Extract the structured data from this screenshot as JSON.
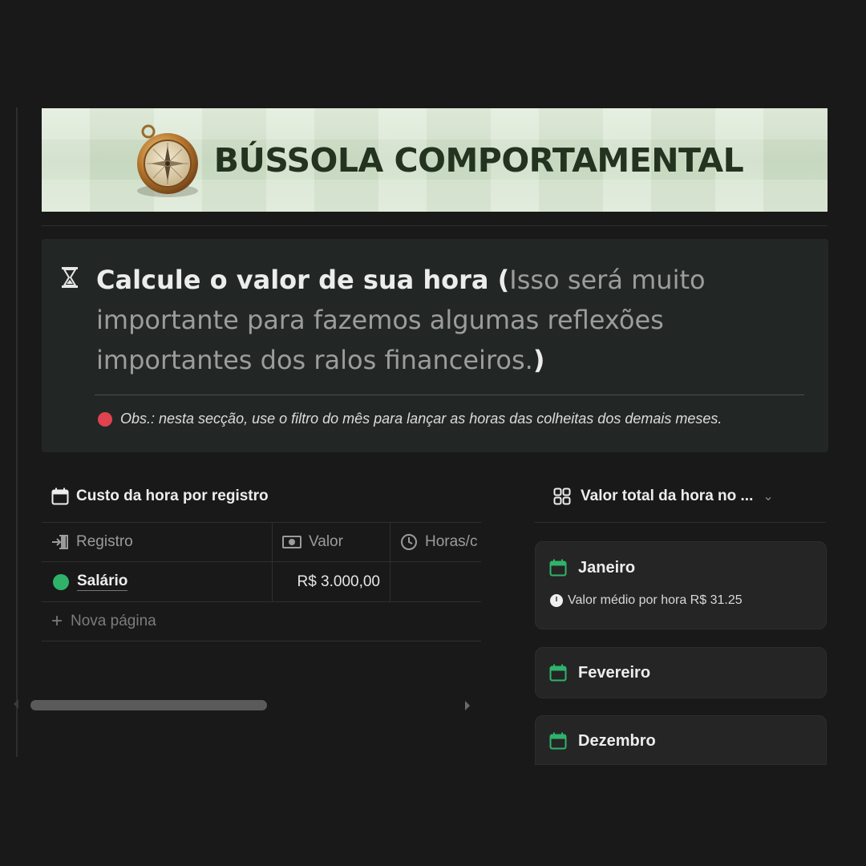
{
  "banner": {
    "title": "BÚSSOLA COMPORTAMENTAL",
    "icon": "compass-icon"
  },
  "callout": {
    "icon": "hourglass-icon",
    "heading_strong": "Calcule o valor de sua hora",
    "heading_paren_open": " (",
    "heading_muted": "Isso será muito importante para fazemos algumas reflexões importantes dos ralos financeiros.",
    "heading_paren_close": ")",
    "note": "Obs.: nesta secção, use o filtro do mês para lançar as horas das colheitas dos demais meses.",
    "note_dot_color": "#e0424f"
  },
  "table": {
    "title": "Custo da hora por registro",
    "columns": [
      {
        "label": "Registro",
        "icon": "enter-icon"
      },
      {
        "label": "Valor",
        "icon": "money-icon"
      },
      {
        "label": "Horas/c",
        "icon": "clock-icon"
      }
    ],
    "rows": [
      {
        "name": "Salário",
        "value": "R$ 3.000,00",
        "hours": "",
        "dot_color": "#2fb36b"
      }
    ],
    "new_page_label": "Nova página"
  },
  "gallery": {
    "title": "Valor total da hora no ...",
    "icon": "gallery-grid-icon",
    "cards": [
      {
        "title": "Janeiro",
        "prop_label": "Valor médio por hora R$ 31.25"
      },
      {
        "title": "Fevereiro"
      },
      {
        "title": "Dezembro"
      }
    ],
    "accent_color": "#2fb36b"
  }
}
